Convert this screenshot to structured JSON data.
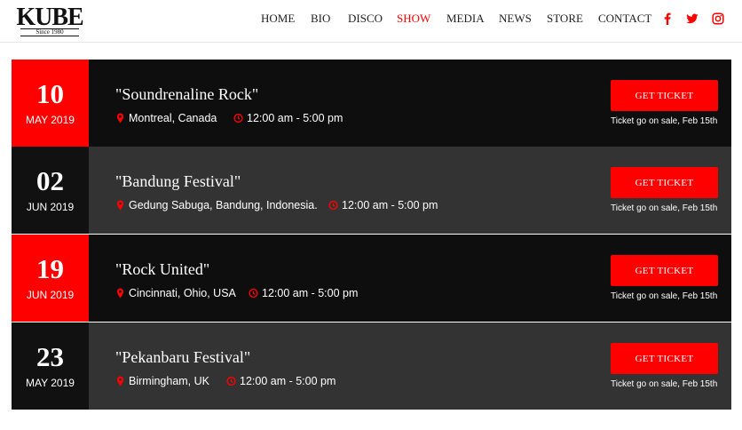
{
  "brand": {
    "logo_text": "KUBE",
    "logo_sub": "Since 1980"
  },
  "nav": {
    "items": [
      "HOME",
      "BIO",
      "DISCO",
      "SHOW",
      "MEDIA",
      "NEWS",
      "STORE",
      "CONTACT"
    ],
    "active": "SHOW",
    "social_icons": [
      "facebook-icon",
      "twitter-icon",
      "instagram-icon"
    ]
  },
  "colors": {
    "accent": "#ff0000",
    "row_dark": "#0e0e0e",
    "row_gray": "#333333",
    "date_black": "#111111"
  },
  "shows": [
    {
      "day": "10",
      "month": "MAY 2019",
      "title": "\"Soundrenaline Rock\"",
      "location": "Montreal, Canada",
      "time": "12:00 am - 5:00 pm",
      "button": "GET TICKET",
      "note": "Ticket go on sale, Feb 15th"
    },
    {
      "day": "02",
      "month": "JUN 2019",
      "title": "\"Bandung Festival\"",
      "location": "Gedung Sabuga, Bandung, Indonesia.",
      "time": "12:00 am - 5:00 pm",
      "button": "GET TICKET",
      "note": "Ticket go on sale, Feb 15th"
    },
    {
      "day": "19",
      "month": "JUN 2019",
      "title": "\"Rock United\"",
      "location": "Cincinnati, Ohio, USA",
      "time": "12:00 am - 5:00 pm",
      "button": "GET TICKET",
      "note": "Ticket go on sale, Feb 15th"
    },
    {
      "day": "23",
      "month": "MAY 2019",
      "title": "\"Pekanbaru Festival\"",
      "location": "Birmingham, UK",
      "time": "12:00 am - 5:00 pm",
      "button": "GET TICKET",
      "note": "Ticket go on sale, Feb 15th"
    }
  ]
}
